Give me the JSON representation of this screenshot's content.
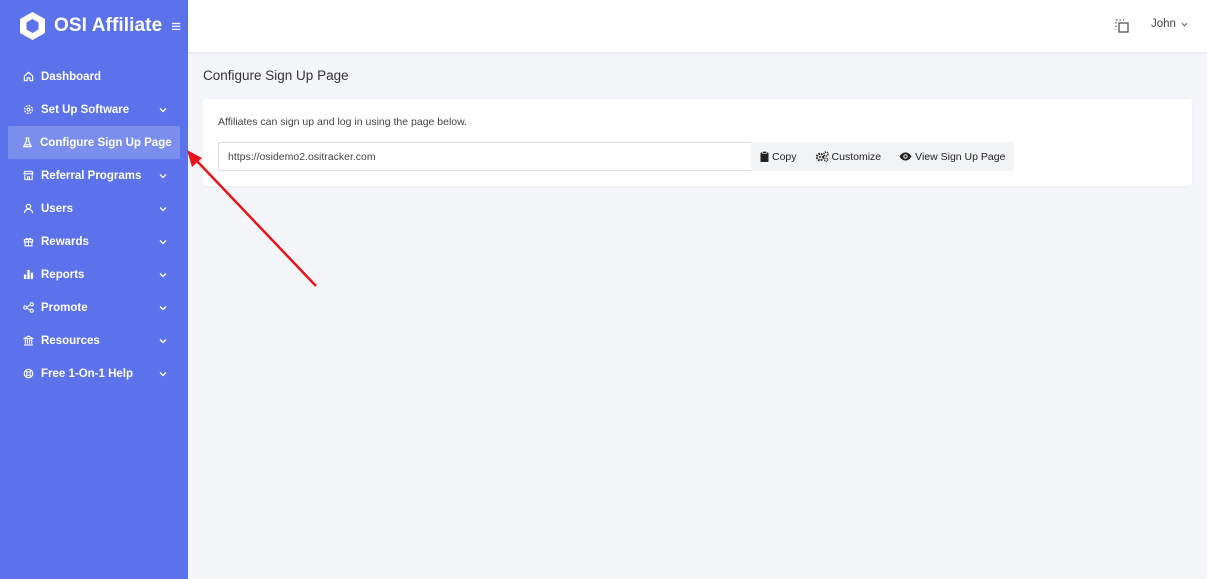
{
  "brand": {
    "name": "OSI Affiliate",
    "menu_icon": "hamburger-icon"
  },
  "sidebar": {
    "items": [
      {
        "label": "Dashboard",
        "icon": "home-icon",
        "has_children": false,
        "active": false
      },
      {
        "label": "Set Up Software",
        "icon": "gear-icon",
        "has_children": true,
        "active": false
      },
      {
        "label": "Configure Sign Up Page",
        "icon": "flask-icon",
        "has_children": false,
        "active": true
      },
      {
        "label": "Referral Programs",
        "icon": "store-icon",
        "has_children": true,
        "active": false
      },
      {
        "label": "Users",
        "icon": "user-icon",
        "has_children": true,
        "active": false
      },
      {
        "label": "Rewards",
        "icon": "gift-icon",
        "has_children": true,
        "active": false
      },
      {
        "label": "Reports",
        "icon": "bar-chart-icon",
        "has_children": true,
        "active": false
      },
      {
        "label": "Promote",
        "icon": "share-icon",
        "has_children": true,
        "active": false
      },
      {
        "label": "Resources",
        "icon": "bank-icon",
        "has_children": true,
        "active": false
      },
      {
        "label": "Free 1-On-1 Help",
        "icon": "lifebuoy-icon",
        "has_children": true,
        "active": false
      }
    ]
  },
  "header": {
    "user_name": "John",
    "action_icon": "copy-square-icon"
  },
  "page": {
    "title": "Configure Sign Up Page"
  },
  "card": {
    "description": "Affiliates can sign up and log in using the page below.",
    "url_value": "https://osidemo2.ositracker.com",
    "buttons": {
      "copy": "Copy",
      "customize": "Customize",
      "view": "View Sign Up Page"
    }
  },
  "colors": {
    "sidebar_bg": "#5b72ea",
    "annotation_arrow": "#e8141a",
    "page_bg": "#f4f5f8"
  }
}
